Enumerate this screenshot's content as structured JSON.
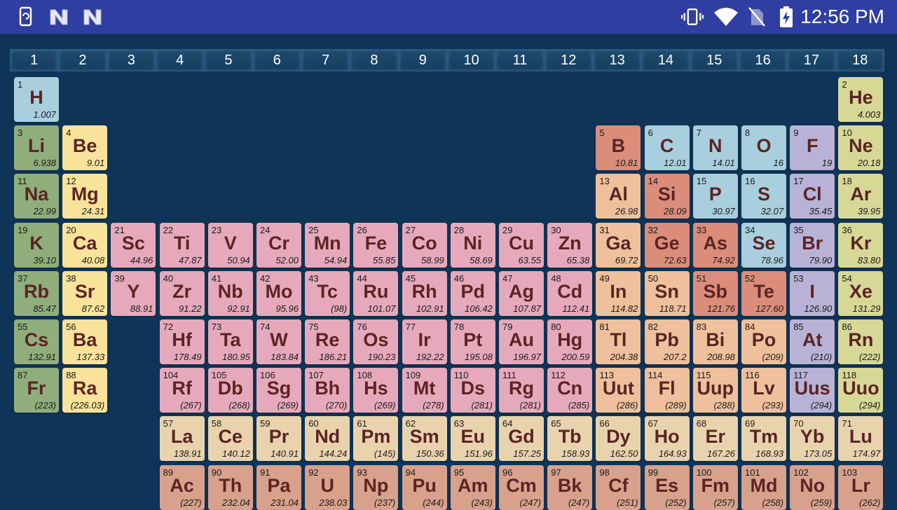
{
  "status_bar": {
    "left_icons": [
      "phone-sync-icon",
      "n-logo-icon",
      "n-logo-icon"
    ],
    "right_icons": [
      "vibrate-icon",
      "wifi-icon",
      "no-sim-icon",
      "battery-charging-icon"
    ],
    "time": "12:56 PM"
  },
  "groups": [
    "1",
    "2",
    "3",
    "4",
    "5",
    "6",
    "7",
    "8",
    "9",
    "10",
    "11",
    "12",
    "13",
    "14",
    "15",
    "16",
    "17",
    "18"
  ],
  "category_colors": {
    "hydrogen": "#a9cfde",
    "alkali": "#8fae7c",
    "alkaline": "#f8e39a",
    "transition": "#e6a9bb",
    "post": "#efc09b",
    "metalloid": "#db8d7a",
    "nonmetal": "#a9cfde",
    "halogen": "#b8b3d6",
    "noble": "#d7d895",
    "lanth": "#e9d3ad",
    "actin": "#d8a18b"
  },
  "elements": [
    {
      "n": "1",
      "s": "H",
      "m": "1.007",
      "col": 1,
      "row": 1,
      "t": "hydrogen"
    },
    {
      "n": "2",
      "s": "He",
      "m": "4.003",
      "col": 18,
      "row": 1,
      "t": "noble"
    },
    {
      "n": "3",
      "s": "Li",
      "m": "6.938",
      "col": 1,
      "row": 2,
      "t": "alkali"
    },
    {
      "n": "4",
      "s": "Be",
      "m": "9.01",
      "col": 2,
      "row": 2,
      "t": "alkaline"
    },
    {
      "n": "5",
      "s": "B",
      "m": "10.81",
      "col": 13,
      "row": 2,
      "t": "metalloid"
    },
    {
      "n": "6",
      "s": "C",
      "m": "12.01",
      "col": 14,
      "row": 2,
      "t": "nonmetal"
    },
    {
      "n": "7",
      "s": "N",
      "m": "14.01",
      "col": 15,
      "row": 2,
      "t": "nonmetal"
    },
    {
      "n": "8",
      "s": "O",
      "m": "16",
      "col": 16,
      "row": 2,
      "t": "nonmetal"
    },
    {
      "n": "9",
      "s": "F",
      "m": "19",
      "col": 17,
      "row": 2,
      "t": "halogen"
    },
    {
      "n": "10",
      "s": "Ne",
      "m": "20.18",
      "col": 18,
      "row": 2,
      "t": "noble"
    },
    {
      "n": "11",
      "s": "Na",
      "m": "22.99",
      "col": 1,
      "row": 3,
      "t": "alkali"
    },
    {
      "n": "12",
      "s": "Mg",
      "m": "24.31",
      "col": 2,
      "row": 3,
      "t": "alkaline"
    },
    {
      "n": "13",
      "s": "Al",
      "m": "26.98",
      "col": 13,
      "row": 3,
      "t": "post"
    },
    {
      "n": "14",
      "s": "Si",
      "m": "28.09",
      "col": 14,
      "row": 3,
      "t": "metalloid"
    },
    {
      "n": "15",
      "s": "P",
      "m": "30.97",
      "col": 15,
      "row": 3,
      "t": "nonmetal"
    },
    {
      "n": "16",
      "s": "S",
      "m": "32.07",
      "col": 16,
      "row": 3,
      "t": "nonmetal"
    },
    {
      "n": "17",
      "s": "Cl",
      "m": "35.45",
      "col": 17,
      "row": 3,
      "t": "halogen"
    },
    {
      "n": "18",
      "s": "Ar",
      "m": "39.95",
      "col": 18,
      "row": 3,
      "t": "noble"
    },
    {
      "n": "19",
      "s": "K",
      "m": "39.10",
      "col": 1,
      "row": 4,
      "t": "alkali"
    },
    {
      "n": "20",
      "s": "Ca",
      "m": "40.08",
      "col": 2,
      "row": 4,
      "t": "alkaline"
    },
    {
      "n": "21",
      "s": "Sc",
      "m": "44.96",
      "col": 3,
      "row": 4,
      "t": "transition"
    },
    {
      "n": "22",
      "s": "Ti",
      "m": "47.87",
      "col": 4,
      "row": 4,
      "t": "transition"
    },
    {
      "n": "23",
      "s": "V",
      "m": "50.94",
      "col": 5,
      "row": 4,
      "t": "transition"
    },
    {
      "n": "24",
      "s": "Cr",
      "m": "52.00",
      "col": 6,
      "row": 4,
      "t": "transition"
    },
    {
      "n": "25",
      "s": "Mn",
      "m": "54.94",
      "col": 7,
      "row": 4,
      "t": "transition"
    },
    {
      "n": "26",
      "s": "Fe",
      "m": "55.85",
      "col": 8,
      "row": 4,
      "t": "transition"
    },
    {
      "n": "27",
      "s": "Co",
      "m": "58.99",
      "col": 9,
      "row": 4,
      "t": "transition"
    },
    {
      "n": "28",
      "s": "Ni",
      "m": "58.69",
      "col": 10,
      "row": 4,
      "t": "transition"
    },
    {
      "n": "29",
      "s": "Cu",
      "m": "63.55",
      "col": 11,
      "row": 4,
      "t": "transition"
    },
    {
      "n": "30",
      "s": "Zn",
      "m": "65.38",
      "col": 12,
      "row": 4,
      "t": "transition"
    },
    {
      "n": "31",
      "s": "Ga",
      "m": "69.72",
      "col": 13,
      "row": 4,
      "t": "post"
    },
    {
      "n": "32",
      "s": "Ge",
      "m": "72.63",
      "col": 14,
      "row": 4,
      "t": "metalloid"
    },
    {
      "n": "33",
      "s": "As",
      "m": "74.92",
      "col": 15,
      "row": 4,
      "t": "metalloid"
    },
    {
      "n": "34",
      "s": "Se",
      "m": "78.96",
      "col": 16,
      "row": 4,
      "t": "nonmetal"
    },
    {
      "n": "35",
      "s": "Br",
      "m": "79.90",
      "col": 17,
      "row": 4,
      "t": "halogen"
    },
    {
      "n": "36",
      "s": "Kr",
      "m": "83.80",
      "col": 18,
      "row": 4,
      "t": "noble"
    },
    {
      "n": "37",
      "s": "Rb",
      "m": "85.47",
      "col": 1,
      "row": 5,
      "t": "alkali"
    },
    {
      "n": "38",
      "s": "Sr",
      "m": "87.62",
      "col": 2,
      "row": 5,
      "t": "alkaline"
    },
    {
      "n": "39",
      "s": "Y",
      "m": "88.91",
      "col": 3,
      "row": 5,
      "t": "transition"
    },
    {
      "n": "40",
      "s": "Zr",
      "m": "91.22",
      "col": 4,
      "row": 5,
      "t": "transition"
    },
    {
      "n": "41",
      "s": "Nb",
      "m": "92.91",
      "col": 5,
      "row": 5,
      "t": "transition"
    },
    {
      "n": "42",
      "s": "Mo",
      "m": "95.96",
      "col": 6,
      "row": 5,
      "t": "transition"
    },
    {
      "n": "43",
      "s": "Tc",
      "m": "(98)",
      "col": 7,
      "row": 5,
      "t": "transition"
    },
    {
      "n": "44",
      "s": "Ru",
      "m": "101.07",
      "col": 8,
      "row": 5,
      "t": "transition"
    },
    {
      "n": "45",
      "s": "Rh",
      "m": "102.91",
      "col": 9,
      "row": 5,
      "t": "transition"
    },
    {
      "n": "46",
      "s": "Pd",
      "m": "106.42",
      "col": 10,
      "row": 5,
      "t": "transition"
    },
    {
      "n": "47",
      "s": "Ag",
      "m": "107.87",
      "col": 11,
      "row": 5,
      "t": "transition"
    },
    {
      "n": "48",
      "s": "Cd",
      "m": "112.41",
      "col": 12,
      "row": 5,
      "t": "transition"
    },
    {
      "n": "49",
      "s": "In",
      "m": "114.82",
      "col": 13,
      "row": 5,
      "t": "post"
    },
    {
      "n": "50",
      "s": "Sn",
      "m": "118.71",
      "col": 14,
      "row": 5,
      "t": "post"
    },
    {
      "n": "51",
      "s": "Sb",
      "m": "121.76",
      "col": 15,
      "row": 5,
      "t": "metalloid"
    },
    {
      "n": "52",
      "s": "Te",
      "m": "127.60",
      "col": 16,
      "row": 5,
      "t": "metalloid"
    },
    {
      "n": "53",
      "s": "I",
      "m": "126.90",
      "col": 17,
      "row": 5,
      "t": "halogen"
    },
    {
      "n": "54",
      "s": "Xe",
      "m": "131.29",
      "col": 18,
      "row": 5,
      "t": "noble"
    },
    {
      "n": "55",
      "s": "Cs",
      "m": "132.91",
      "col": 1,
      "row": 6,
      "t": "alkali"
    },
    {
      "n": "56",
      "s": "Ba",
      "m": "137.33",
      "col": 2,
      "row": 6,
      "t": "alkaline"
    },
    {
      "n": "72",
      "s": "Hf",
      "m": "178.49",
      "col": 4,
      "row": 6,
      "t": "transition"
    },
    {
      "n": "73",
      "s": "Ta",
      "m": "180.95",
      "col": 5,
      "row": 6,
      "t": "transition"
    },
    {
      "n": "74",
      "s": "W",
      "m": "183.84",
      "col": 6,
      "row": 6,
      "t": "transition"
    },
    {
      "n": "75",
      "s": "Re",
      "m": "186.21",
      "col": 7,
      "row": 6,
      "t": "transition"
    },
    {
      "n": "76",
      "s": "Os",
      "m": "190.23",
      "col": 8,
      "row": 6,
      "t": "transition"
    },
    {
      "n": "77",
      "s": "Ir",
      "m": "192.22",
      "col": 9,
      "row": 6,
      "t": "transition"
    },
    {
      "n": "78",
      "s": "Pt",
      "m": "195.08",
      "col": 10,
      "row": 6,
      "t": "transition"
    },
    {
      "n": "79",
      "s": "Au",
      "m": "196.97",
      "col": 11,
      "row": 6,
      "t": "transition"
    },
    {
      "n": "80",
      "s": "Hg",
      "m": "200.59",
      "col": 12,
      "row": 6,
      "t": "transition"
    },
    {
      "n": "81",
      "s": "Tl",
      "m": "204.38",
      "col": 13,
      "row": 6,
      "t": "post"
    },
    {
      "n": "82",
      "s": "Pb",
      "m": "207.2",
      "col": 14,
      "row": 6,
      "t": "post"
    },
    {
      "n": "83",
      "s": "Bi",
      "m": "208.98",
      "col": 15,
      "row": 6,
      "t": "post"
    },
    {
      "n": "84",
      "s": "Po",
      "m": "(209)",
      "col": 16,
      "row": 6,
      "t": "post"
    },
    {
      "n": "85",
      "s": "At",
      "m": "(210)",
      "col": 17,
      "row": 6,
      "t": "halogen"
    },
    {
      "n": "86",
      "s": "Rn",
      "m": "(222)",
      "col": 18,
      "row": 6,
      "t": "noble"
    },
    {
      "n": "87",
      "s": "Fr",
      "m": "(223)",
      "col": 1,
      "row": 7,
      "t": "alkali"
    },
    {
      "n": "88",
      "s": "Ra",
      "m": "(226.03)",
      "col": 2,
      "row": 7,
      "t": "alkaline"
    },
    {
      "n": "104",
      "s": "Rf",
      "m": "(267)",
      "col": 4,
      "row": 7,
      "t": "transition"
    },
    {
      "n": "105",
      "s": "Db",
      "m": "(268)",
      "col": 5,
      "row": 7,
      "t": "transition"
    },
    {
      "n": "106",
      "s": "Sg",
      "m": "(269)",
      "col": 6,
      "row": 7,
      "t": "transition"
    },
    {
      "n": "107",
      "s": "Bh",
      "m": "(270)",
      "col": 7,
      "row": 7,
      "t": "transition"
    },
    {
      "n": "108",
      "s": "Hs",
      "m": "(269)",
      "col": 8,
      "row": 7,
      "t": "transition"
    },
    {
      "n": "109",
      "s": "Mt",
      "m": "(278)",
      "col": 9,
      "row": 7,
      "t": "transition"
    },
    {
      "n": "110",
      "s": "Ds",
      "m": "(281)",
      "col": 10,
      "row": 7,
      "t": "transition"
    },
    {
      "n": "111",
      "s": "Rg",
      "m": "(281)",
      "col": 11,
      "row": 7,
      "t": "transition"
    },
    {
      "n": "112",
      "s": "Cn",
      "m": "(285)",
      "col": 12,
      "row": 7,
      "t": "transition"
    },
    {
      "n": "113",
      "s": "Uut",
      "m": "(286)",
      "col": 13,
      "row": 7,
      "t": "post"
    },
    {
      "n": "114",
      "s": "Fl",
      "m": "(289)",
      "col": 14,
      "row": 7,
      "t": "post"
    },
    {
      "n": "115",
      "s": "Uup",
      "m": "(288)",
      "col": 15,
      "row": 7,
      "t": "post"
    },
    {
      "n": "116",
      "s": "Lv",
      "m": "(293)",
      "col": 16,
      "row": 7,
      "t": "post"
    },
    {
      "n": "117",
      "s": "Uus",
      "m": "(294)",
      "col": 17,
      "row": 7,
      "t": "halogen"
    },
    {
      "n": "118",
      "s": "Uuo",
      "m": "(294)",
      "col": 18,
      "row": 7,
      "t": "noble"
    },
    {
      "n": "57",
      "s": "La",
      "m": "138.91",
      "col": 4,
      "row": 8,
      "t": "lanth"
    },
    {
      "n": "58",
      "s": "Ce",
      "m": "140.12",
      "col": 5,
      "row": 8,
      "t": "lanth"
    },
    {
      "n": "59",
      "s": "Pr",
      "m": "140.91",
      "col": 6,
      "row": 8,
      "t": "lanth"
    },
    {
      "n": "60",
      "s": "Nd",
      "m": "144.24",
      "col": 7,
      "row": 8,
      "t": "lanth"
    },
    {
      "n": "61",
      "s": "Pm",
      "m": "(145)",
      "col": 8,
      "row": 8,
      "t": "lanth"
    },
    {
      "n": "62",
      "s": "Sm",
      "m": "150.36",
      "col": 9,
      "row": 8,
      "t": "lanth"
    },
    {
      "n": "63",
      "s": "Eu",
      "m": "151.96",
      "col": 10,
      "row": 8,
      "t": "lanth"
    },
    {
      "n": "64",
      "s": "Gd",
      "m": "157.25",
      "col": 11,
      "row": 8,
      "t": "lanth"
    },
    {
      "n": "65",
      "s": "Tb",
      "m": "158.93",
      "col": 12,
      "row": 8,
      "t": "lanth"
    },
    {
      "n": "66",
      "s": "Dy",
      "m": "162.50",
      "col": 13,
      "row": 8,
      "t": "lanth"
    },
    {
      "n": "67",
      "s": "Ho",
      "m": "164.93",
      "col": 14,
      "row": 8,
      "t": "lanth"
    },
    {
      "n": "68",
      "s": "Er",
      "m": "167.26",
      "col": 15,
      "row": 8,
      "t": "lanth"
    },
    {
      "n": "69",
      "s": "Tm",
      "m": "168.93",
      "col": 16,
      "row": 8,
      "t": "lanth"
    },
    {
      "n": "70",
      "s": "Yb",
      "m": "173.05",
      "col": 17,
      "row": 8,
      "t": "lanth"
    },
    {
      "n": "71",
      "s": "Lu",
      "m": "174.97",
      "col": 18,
      "row": 8,
      "t": "lanth"
    },
    {
      "n": "89",
      "s": "Ac",
      "m": "(227)",
      "col": 4,
      "row": 9,
      "t": "actin"
    },
    {
      "n": "90",
      "s": "Th",
      "m": "232.04",
      "col": 5,
      "row": 9,
      "t": "actin"
    },
    {
      "n": "91",
      "s": "Pa",
      "m": "231.04",
      "col": 6,
      "row": 9,
      "t": "actin"
    },
    {
      "n": "92",
      "s": "U",
      "m": "238.03",
      "col": 7,
      "row": 9,
      "t": "actin"
    },
    {
      "n": "93",
      "s": "Np",
      "m": "(237)",
      "col": 8,
      "row": 9,
      "t": "actin"
    },
    {
      "n": "94",
      "s": "Pu",
      "m": "(244)",
      "col": 9,
      "row": 9,
      "t": "actin"
    },
    {
      "n": "95",
      "s": "Am",
      "m": "(243)",
      "col": 10,
      "row": 9,
      "t": "actin"
    },
    {
      "n": "96",
      "s": "Cm",
      "m": "(247)",
      "col": 11,
      "row": 9,
      "t": "actin"
    },
    {
      "n": "97",
      "s": "Bk",
      "m": "(247)",
      "col": 12,
      "row": 9,
      "t": "actin"
    },
    {
      "n": "98",
      "s": "Cf",
      "m": "(251)",
      "col": 13,
      "row": 9,
      "t": "actin"
    },
    {
      "n": "99",
      "s": "Es",
      "m": "(252)",
      "col": 14,
      "row": 9,
      "t": "actin"
    },
    {
      "n": "100",
      "s": "Fm",
      "m": "(257)",
      "col": 15,
      "row": 9,
      "t": "actin"
    },
    {
      "n": "101",
      "s": "Md",
      "m": "(258)",
      "col": 16,
      "row": 9,
      "t": "actin"
    },
    {
      "n": "102",
      "s": "No",
      "m": "(259)",
      "col": 17,
      "row": 9,
      "t": "actin"
    },
    {
      "n": "103",
      "s": "Lr",
      "m": "(262)",
      "col": 18,
      "row": 9,
      "t": "actin"
    }
  ]
}
